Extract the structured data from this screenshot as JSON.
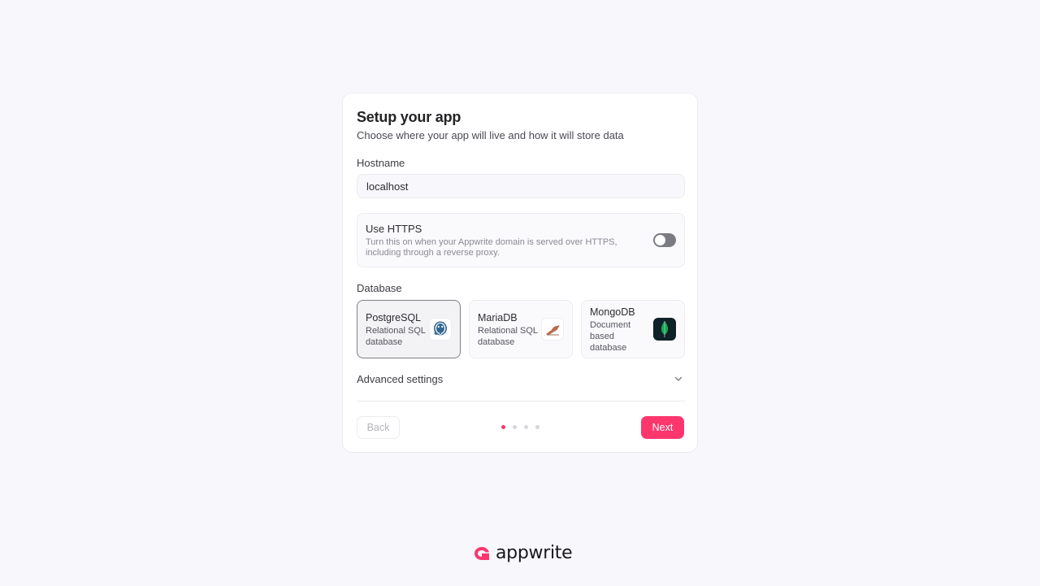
{
  "setup": {
    "title": "Setup your app",
    "subtitle": "Choose where your app will live and how it will store data"
  },
  "hostname": {
    "label": "Hostname",
    "value": "localhost"
  },
  "https": {
    "title": "Use HTTPS",
    "description": "Turn this on when your Appwrite domain is served over HTTPS, including through a reverse proxy.",
    "enabled": false
  },
  "database": {
    "label": "Database",
    "selected": "PostgreSQL",
    "options": [
      {
        "name": "PostgreSQL",
        "description": "Relational SQL database",
        "icon": "postgresql-icon"
      },
      {
        "name": "MariaDB",
        "description": "Relational SQL database",
        "icon": "mariadb-icon"
      },
      {
        "name": "MongoDB",
        "description": "Document based database",
        "icon": "mongodb-icon"
      }
    ]
  },
  "advanced": {
    "label": "Advanced settings",
    "icon": "chevron-down-icon"
  },
  "footer": {
    "back_label": "Back",
    "next_label": "Next",
    "steps_total": 4,
    "step_current": 1
  },
  "brand": {
    "name": "appwrite",
    "accent": "#fd366e"
  }
}
